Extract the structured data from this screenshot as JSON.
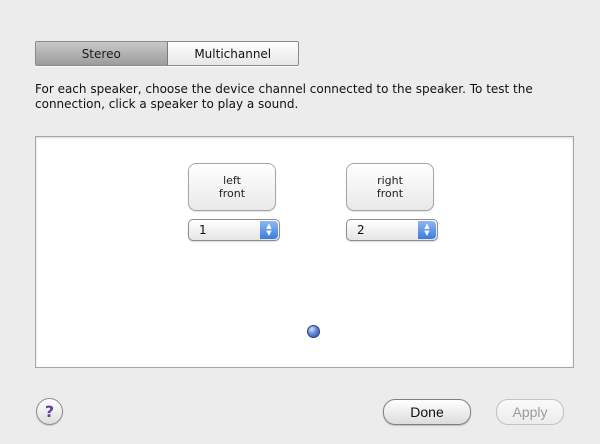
{
  "tabs": [
    {
      "label": "Stereo",
      "selected": true
    },
    {
      "label": "Multichannel",
      "selected": false
    }
  ],
  "instructions": "For each speaker, choose the device channel connected to the speaker. To test the connection, click a speaker to play a sound.",
  "speakers": [
    {
      "line1": "left",
      "line2": "front",
      "channel": "1"
    },
    {
      "line1": "right",
      "line2": "front",
      "channel": "2"
    }
  ],
  "listener_icon": "listener-dot-icon",
  "buttons": {
    "help": "?",
    "done": "Done",
    "apply": "Apply"
  },
  "colors": {
    "popup_arrows": "#3b7de2",
    "help_glyph": "#6b3fa0"
  }
}
